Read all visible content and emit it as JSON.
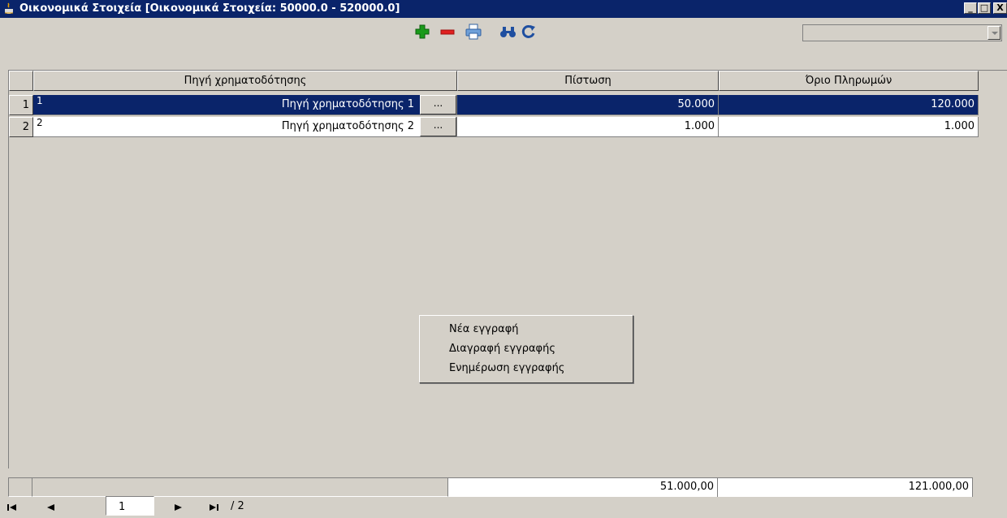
{
  "window": {
    "title": "Οικονομικά Στοιχεία [Οικονομικά Στοιχεία: 50000.0 - 520000.0]",
    "icon": "java-cup-icon",
    "controls": [
      "_",
      "□",
      "X"
    ]
  },
  "toolbar": {
    "icons": [
      "add-icon",
      "remove-icon",
      "print-icon",
      "find-icon",
      "refresh-icon"
    ],
    "combo_value": ""
  },
  "table": {
    "columns": [
      "Πηγή χρηματοδότησης",
      "Πίστωση",
      "Όριο Πληρωμών"
    ],
    "rows": [
      {
        "row_no": "1",
        "code": "1",
        "name": "Πηγή χρηματοδότησης 1",
        "button": "...",
        "credit": "50.000",
        "payment_limit": "120.000",
        "selected": true
      },
      {
        "row_no": "2",
        "code": "2",
        "name": "Πηγή χρηματοδότησης 2",
        "button": "...",
        "credit": "1.000",
        "payment_limit": "1.000",
        "selected": false
      }
    ],
    "totals": {
      "credit": "51.000,00",
      "payment_limit": "121.000,00"
    }
  },
  "context_menu": {
    "items": [
      "Νέα εγγραφή",
      "Διαγραφή εγγραφής",
      "Ενημέρωση εγγραφής"
    ]
  },
  "pager": {
    "first": "⏮",
    "prev": "◄",
    "current_page": "1",
    "next": "►",
    "last": "⏭",
    "total": "/ 2"
  },
  "colors": {
    "selection": "#0a246a",
    "add": "#1a9a1a",
    "remove": "#e02020",
    "refresh": "#1f4fa0"
  }
}
